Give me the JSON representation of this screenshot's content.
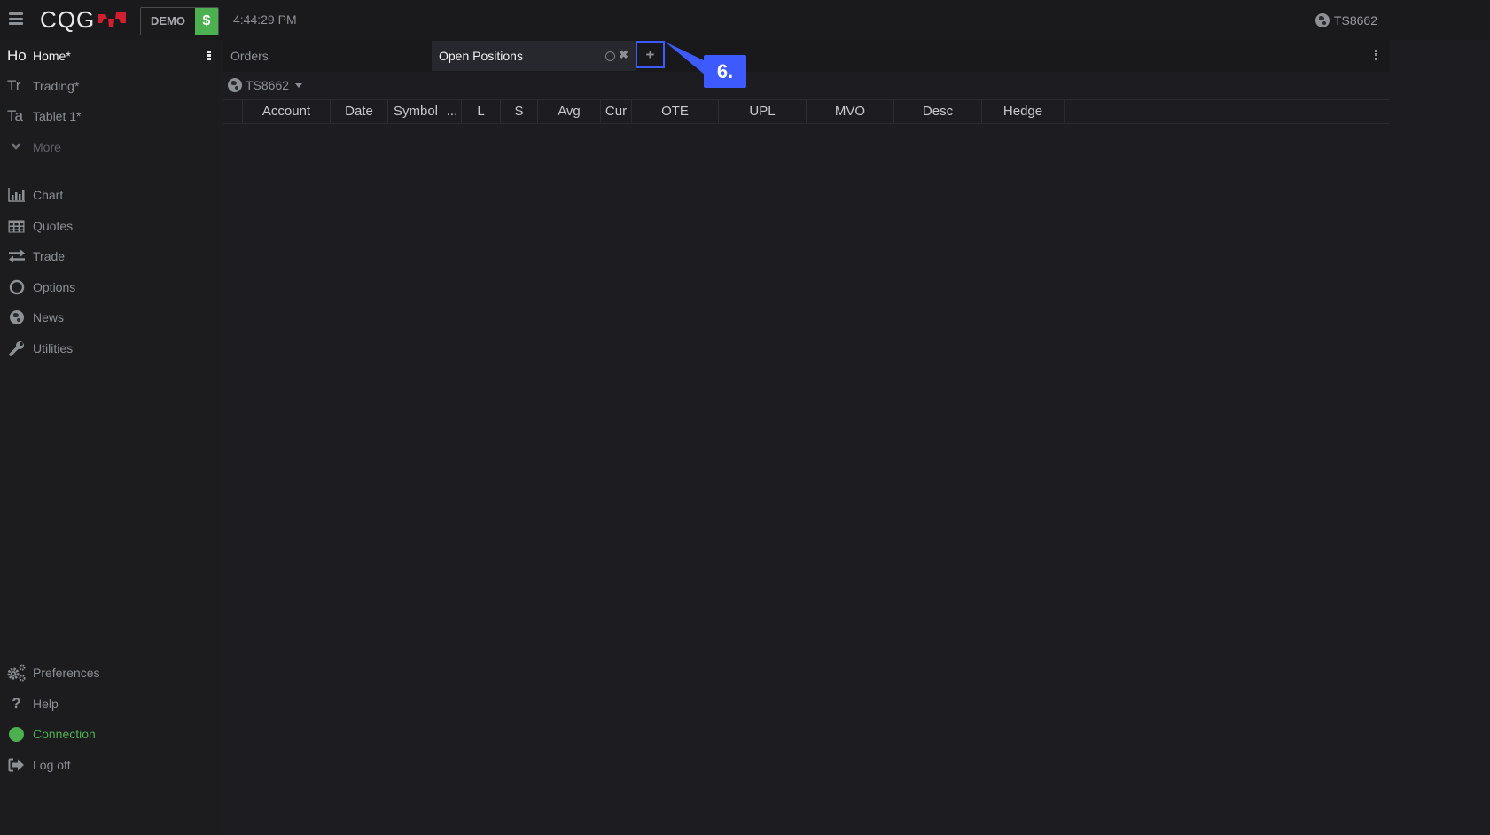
{
  "topbar": {
    "logo_text": "CQG",
    "mode_label": "DEMO",
    "dollar_label": "$",
    "time": "4:44:29 PM",
    "account": "TS8662"
  },
  "sidebar": {
    "workspaces": [
      {
        "abbr": "Ho",
        "label": "Home*",
        "active": true
      },
      {
        "abbr": "Tr",
        "label": "Trading*",
        "active": false
      },
      {
        "abbr": "Ta",
        "label": "Tablet 1*",
        "active": false
      }
    ],
    "more_label": "More",
    "nav": [
      {
        "icon": "bar-chart-icon",
        "label": "Chart"
      },
      {
        "icon": "table-icon",
        "label": "Quotes"
      },
      {
        "icon": "exchange-icon",
        "label": "Trade"
      },
      {
        "icon": "circle-icon",
        "label": "Options"
      },
      {
        "icon": "globe-icon",
        "label": "News"
      },
      {
        "icon": "wrench-icon",
        "label": "Utilities"
      }
    ],
    "bottom": [
      {
        "icon": "gears-icon",
        "label": "Preferences"
      },
      {
        "icon": "question-icon",
        "label": "Help"
      },
      {
        "icon": "connection-status-icon",
        "label": "Connection"
      },
      {
        "icon": "sign-out-icon",
        "label": "Log off"
      }
    ]
  },
  "main": {
    "tabs": [
      {
        "label": "Orders",
        "active": false
      },
      {
        "label": "Open Positions",
        "active": true
      }
    ],
    "add_tab_label": "+",
    "callout_label": "6.",
    "account_selector": "TS8662",
    "columns": [
      "Account",
      "Date",
      "Symbol",
      "...",
      "L",
      "S",
      "Avg",
      "Cur",
      "OTE",
      "UPL",
      "MVO",
      "Desc",
      "Hedge"
    ],
    "rows": []
  },
  "colors": {
    "accent_green": "#4caf50",
    "callout_blue": "#3d5afe",
    "logo_red": "#d0202f"
  }
}
